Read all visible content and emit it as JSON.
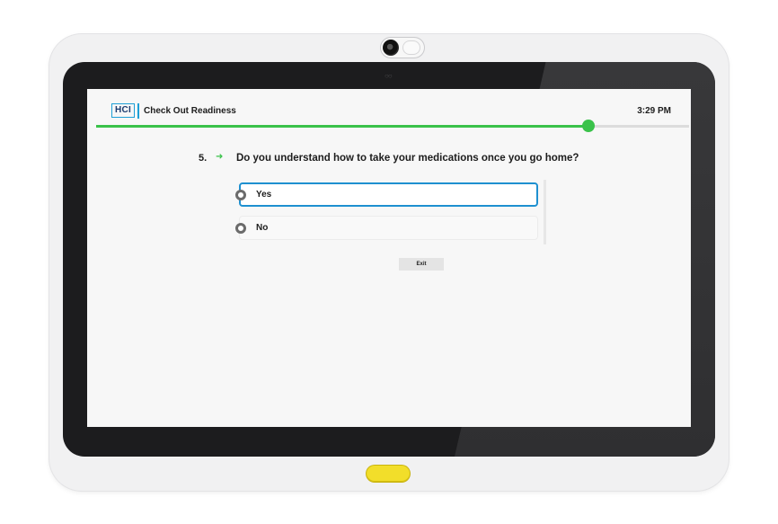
{
  "app": {
    "logo_text": "HCI",
    "title": "Check Out Readiness",
    "time": "3:29 PM"
  },
  "progress": {
    "fraction": 0.83,
    "color": "#3ac24a"
  },
  "question": {
    "number": "5.",
    "arrow_icon": "arrow-right-icon",
    "text": "Do you understand how to take your medications once you go home?"
  },
  "options": [
    {
      "label": "Yes",
      "selected": true
    },
    {
      "label": "No",
      "selected": false
    }
  ],
  "buttons": {
    "exit_label": "Exit"
  },
  "colors": {
    "accent": "#1e90d0",
    "brand": "#1b3b6f",
    "home_button": "#f2de2a"
  }
}
